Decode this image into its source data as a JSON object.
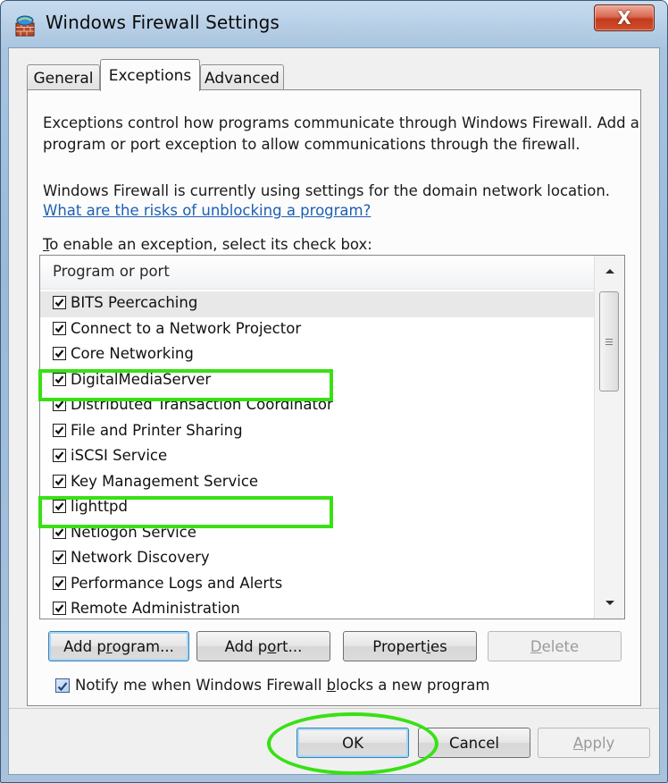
{
  "window": {
    "title": "Windows Firewall Settings",
    "close_glyph": "X"
  },
  "tabs": [
    {
      "label": "General",
      "active": false
    },
    {
      "label": "Exceptions",
      "active": true
    },
    {
      "label": "Advanced",
      "active": false
    }
  ],
  "description": {
    "line1": "Exceptions control how programs communicate through Windows Firewall. Add a",
    "line2": "program or port exception to allow communications through the firewall."
  },
  "status": {
    "line": "Windows Firewall is currently using settings for the domain network location.",
    "risk_link": "What are the risks of unblocking a program?"
  },
  "list_label": {
    "mnemonic": "T",
    "rest": "o enable an exception, select its check box:"
  },
  "list": {
    "header": "Program or port",
    "items": [
      {
        "label": "BITS Peercaching",
        "checked": true,
        "selected": true
      },
      {
        "label": "Connect to a Network Projector",
        "checked": true
      },
      {
        "label": "Core Networking",
        "checked": true
      },
      {
        "label": "DigitalMediaServer",
        "checked": true,
        "highlighted": true
      },
      {
        "label": "Distributed Transaction Coordinator",
        "checked": true
      },
      {
        "label": "File and Printer Sharing",
        "checked": true
      },
      {
        "label": "iSCSI Service",
        "checked": true
      },
      {
        "label": "Key Management Service",
        "checked": true
      },
      {
        "label": "lighttpd",
        "checked": true,
        "highlighted": true
      },
      {
        "label": "Netlogon Service",
        "checked": true
      },
      {
        "label": "Network Discovery",
        "checked": true
      },
      {
        "label": "Performance Logs and Alerts",
        "checked": true
      },
      {
        "label": "Remote Administration",
        "checked": true
      }
    ]
  },
  "buttons": {
    "add_program": {
      "pre": "Add p",
      "mn": "r",
      "post": "ogram..."
    },
    "add_port": {
      "pre": "Add p",
      "mn": "o",
      "post": "rt..."
    },
    "properties": {
      "pre": "Propert",
      "mn": "i",
      "post": "es"
    },
    "delete": {
      "pre": "",
      "mn": "D",
      "post": "elete"
    },
    "ok": "OK",
    "cancel": "Cancel",
    "apply": {
      "pre": "",
      "mn": "A",
      "post": "pply"
    }
  },
  "notify": {
    "pre": "Notify me when Windows Firewall ",
    "mn": "b",
    "post": "locks a new program",
    "checked": true
  },
  "colors": {
    "highlight": "#39e014",
    "link": "#1c5fb4",
    "titlebar": "#a8c4df",
    "close": "#c23a1c"
  }
}
